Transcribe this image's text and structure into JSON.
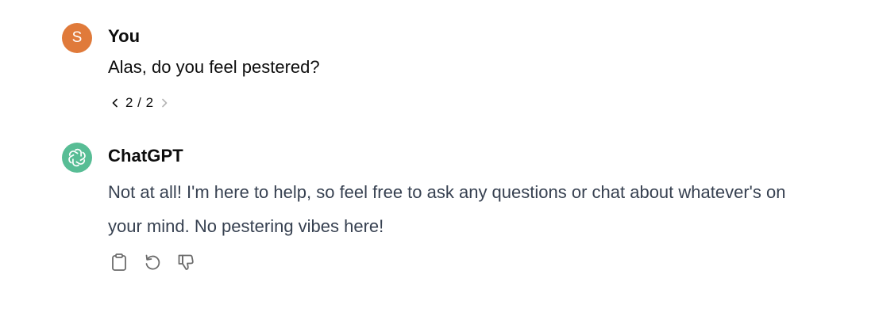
{
  "user_message": {
    "avatar_initial": "S",
    "author": "You",
    "text": "Alas, do you feel pestered?",
    "pager": {
      "current": "2 / 2",
      "prev_icon": "chevron-left-icon",
      "next_icon": "chevron-right-icon"
    }
  },
  "assistant_message": {
    "author": "ChatGPT",
    "text": "Not at all! I'm here to help, so feel free to ask any questions or chat about whatever's on your mind. No pestering vibes here!",
    "actions": [
      "clipboard-icon",
      "regenerate-icon",
      "thumbs-down-icon"
    ]
  },
  "colors": {
    "user_avatar": "#e07a3a",
    "assistant_avatar": "#58bd95",
    "icon_gray": "#6b6b6b"
  }
}
